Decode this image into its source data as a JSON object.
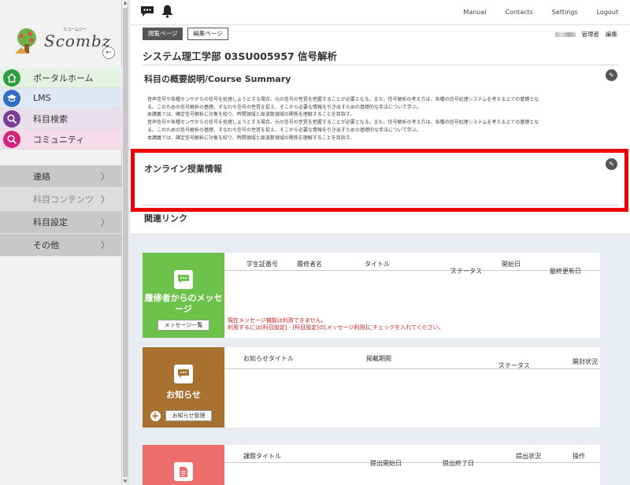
{
  "logo": {
    "text": "Scombz",
    "sub": "スコームジー"
  },
  "nav": [
    {
      "label": "ポータルホーム",
      "icon": "home-icon"
    },
    {
      "label": "LMS",
      "icon": "graduation-cap-icon"
    },
    {
      "label": "科目検索",
      "icon": "search-icon"
    },
    {
      "label": "コミュニティ",
      "icon": "search-icon"
    }
  ],
  "menu": [
    {
      "label": "連絡",
      "chevron": "〉"
    },
    {
      "label": "科目コンテンツ",
      "chevron": "〉"
    },
    {
      "label": "科目設定",
      "chevron": "〉"
    },
    {
      "label": "その他",
      "chevron": "〉"
    }
  ],
  "topbar": {
    "links": [
      "Manual",
      "Contacts",
      "Settings",
      "Logout"
    ]
  },
  "tabs": {
    "view": "閲覧ページ",
    "edit": "編集ページ"
  },
  "user": {
    "role": "管理者",
    "edit": "編集"
  },
  "course": {
    "title": "システム理工学部 03SU005957 信号解析"
  },
  "summary": {
    "title": "科目の概要説明/Course Summary",
    "lines": [
      "音声信号や各種センサからの信号を処理しようとする場合、元の信号の性質を把握することが必要となる。また、信号解析の考え方は、各種の信号処理システムを考える上での基礎とな",
      "る。このための信号解析の基礎、すなわち信号の性質を捉え、そこから必要な情報を引き出すための基礎的な手法について学ぶ。",
      "本講義では、確定信号解析に対象を絞り、時間領域と周波数領域の関係を理解することを目指す。",
      "音声信号や各種センサからの信号を処理しようとする場合、元の信号の性質を把握することが必要となる。また、信号解析の考え方は、各種の信号処理システムを考える上での基礎とな",
      "る。このための信号解析の基礎、すなわち信号の性質を捉え、そこから必要な情報を引き出すための基礎的な手法について学ぶ。",
      "本講義では、確定信号解析に対象を絞り、時間領域と周波数領域の関係を理解することを目指す。"
    ]
  },
  "online": {
    "title": "オンライン授業情報"
  },
  "links": {
    "title": "関連リンク"
  },
  "messages": {
    "panel_title": "履修者からのメッセージ",
    "button": "メッセージ一覧",
    "columns": [
      "学生証番号",
      "履修者名",
      "タイトル",
      "ステータス",
      "開始日",
      "最終更新日"
    ],
    "notice1": "現在メッセージ機能は利用できません。",
    "notice2": "利用するには[科目設定] - [科目設定]の[メッセージ利用]にチェックを入れてください。"
  },
  "news": {
    "panel_title": "お知らせ",
    "button": "お知らせ管理",
    "columns": [
      "お知らせタイトル",
      "掲載期間",
      "ステータス",
      "開封状況"
    ]
  },
  "assignments": {
    "columns": [
      "課題タイトル",
      "提出開始日",
      "提出終了日",
      "提出状況",
      "操作"
    ]
  },
  "colors": {
    "messages": "#6cc24a",
    "news": "#a8712f",
    "assignments": "#ee6e6e",
    "highlight": "#ee0000"
  }
}
